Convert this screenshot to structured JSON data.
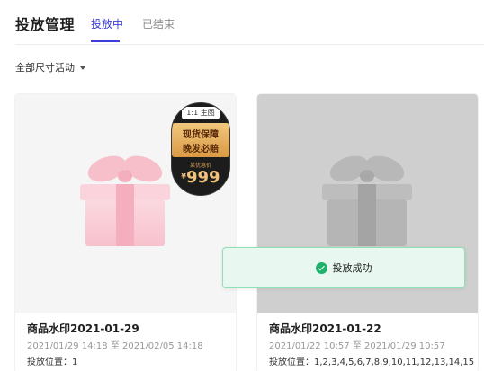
{
  "header": {
    "title": "投放管理",
    "tabs": [
      {
        "label": "投放中",
        "active": true
      },
      {
        "label": "已结束",
        "active": false
      }
    ]
  },
  "filter": {
    "label": "全部尺寸活动"
  },
  "cards": [
    {
      "title": "商品水印2021-01-29",
      "time_range": "2021/01/29 14:18 至 2021/02/05 14:18",
      "position": "投放位置：1",
      "state": "active",
      "badge": {
        "tag": "1:1 主图",
        "line1": "现货保障",
        "line2": "晚发必赔",
        "small": "某优惠价",
        "currency": "¥",
        "price": "999"
      }
    },
    {
      "title": "商品水印2021-01-22",
      "time_range": "2021/01/22 10:57 至 2021/01/29 10:57",
      "position": "投放位置：1,2,3,4,5,6,7,8,9,10,11,12,13,14,15",
      "state": "inactive"
    }
  ],
  "toast": {
    "text": "投放成功",
    "icon": "check-circle-icon"
  },
  "colors": {
    "accent": "#3d3ddb",
    "success": "#1fb26a",
    "toast_bg": "#e8f8f0",
    "gift_pink": "#f7c5d0",
    "gift_gray": "#b3b3b3"
  }
}
